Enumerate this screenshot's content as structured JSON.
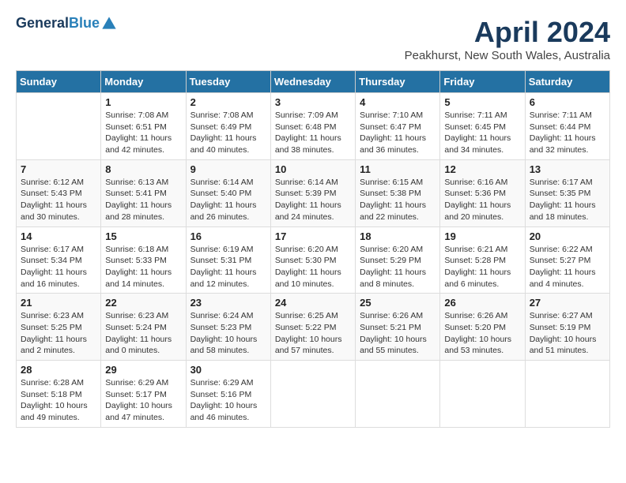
{
  "header": {
    "logo_line1": "General",
    "logo_line2": "Blue",
    "month": "April 2024",
    "location": "Peakhurst, New South Wales, Australia"
  },
  "weekdays": [
    "Sunday",
    "Monday",
    "Tuesday",
    "Wednesday",
    "Thursday",
    "Friday",
    "Saturday"
  ],
  "weeks": [
    [
      {
        "day": "",
        "info": ""
      },
      {
        "day": "1",
        "info": "Sunrise: 7:08 AM\nSunset: 6:51 PM\nDaylight: 11 hours\nand 42 minutes."
      },
      {
        "day": "2",
        "info": "Sunrise: 7:08 AM\nSunset: 6:49 PM\nDaylight: 11 hours\nand 40 minutes."
      },
      {
        "day": "3",
        "info": "Sunrise: 7:09 AM\nSunset: 6:48 PM\nDaylight: 11 hours\nand 38 minutes."
      },
      {
        "day": "4",
        "info": "Sunrise: 7:10 AM\nSunset: 6:47 PM\nDaylight: 11 hours\nand 36 minutes."
      },
      {
        "day": "5",
        "info": "Sunrise: 7:11 AM\nSunset: 6:45 PM\nDaylight: 11 hours\nand 34 minutes."
      },
      {
        "day": "6",
        "info": "Sunrise: 7:11 AM\nSunset: 6:44 PM\nDaylight: 11 hours\nand 32 minutes."
      }
    ],
    [
      {
        "day": "7",
        "info": "Sunrise: 6:12 AM\nSunset: 5:43 PM\nDaylight: 11 hours\nand 30 minutes."
      },
      {
        "day": "8",
        "info": "Sunrise: 6:13 AM\nSunset: 5:41 PM\nDaylight: 11 hours\nand 28 minutes."
      },
      {
        "day": "9",
        "info": "Sunrise: 6:14 AM\nSunset: 5:40 PM\nDaylight: 11 hours\nand 26 minutes."
      },
      {
        "day": "10",
        "info": "Sunrise: 6:14 AM\nSunset: 5:39 PM\nDaylight: 11 hours\nand 24 minutes."
      },
      {
        "day": "11",
        "info": "Sunrise: 6:15 AM\nSunset: 5:38 PM\nDaylight: 11 hours\nand 22 minutes."
      },
      {
        "day": "12",
        "info": "Sunrise: 6:16 AM\nSunset: 5:36 PM\nDaylight: 11 hours\nand 20 minutes."
      },
      {
        "day": "13",
        "info": "Sunrise: 6:17 AM\nSunset: 5:35 PM\nDaylight: 11 hours\nand 18 minutes."
      }
    ],
    [
      {
        "day": "14",
        "info": "Sunrise: 6:17 AM\nSunset: 5:34 PM\nDaylight: 11 hours\nand 16 minutes."
      },
      {
        "day": "15",
        "info": "Sunrise: 6:18 AM\nSunset: 5:33 PM\nDaylight: 11 hours\nand 14 minutes."
      },
      {
        "day": "16",
        "info": "Sunrise: 6:19 AM\nSunset: 5:31 PM\nDaylight: 11 hours\nand 12 minutes."
      },
      {
        "day": "17",
        "info": "Sunrise: 6:20 AM\nSunset: 5:30 PM\nDaylight: 11 hours\nand 10 minutes."
      },
      {
        "day": "18",
        "info": "Sunrise: 6:20 AM\nSunset: 5:29 PM\nDaylight: 11 hours\nand 8 minutes."
      },
      {
        "day": "19",
        "info": "Sunrise: 6:21 AM\nSunset: 5:28 PM\nDaylight: 11 hours\nand 6 minutes."
      },
      {
        "day": "20",
        "info": "Sunrise: 6:22 AM\nSunset: 5:27 PM\nDaylight: 11 hours\nand 4 minutes."
      }
    ],
    [
      {
        "day": "21",
        "info": "Sunrise: 6:23 AM\nSunset: 5:25 PM\nDaylight: 11 hours\nand 2 minutes."
      },
      {
        "day": "22",
        "info": "Sunrise: 6:23 AM\nSunset: 5:24 PM\nDaylight: 11 hours\nand 0 minutes."
      },
      {
        "day": "23",
        "info": "Sunrise: 6:24 AM\nSunset: 5:23 PM\nDaylight: 10 hours\nand 58 minutes."
      },
      {
        "day": "24",
        "info": "Sunrise: 6:25 AM\nSunset: 5:22 PM\nDaylight: 10 hours\nand 57 minutes."
      },
      {
        "day": "25",
        "info": "Sunrise: 6:26 AM\nSunset: 5:21 PM\nDaylight: 10 hours\nand 55 minutes."
      },
      {
        "day": "26",
        "info": "Sunrise: 6:26 AM\nSunset: 5:20 PM\nDaylight: 10 hours\nand 53 minutes."
      },
      {
        "day": "27",
        "info": "Sunrise: 6:27 AM\nSunset: 5:19 PM\nDaylight: 10 hours\nand 51 minutes."
      }
    ],
    [
      {
        "day": "28",
        "info": "Sunrise: 6:28 AM\nSunset: 5:18 PM\nDaylight: 10 hours\nand 49 minutes."
      },
      {
        "day": "29",
        "info": "Sunrise: 6:29 AM\nSunset: 5:17 PM\nDaylight: 10 hours\nand 47 minutes."
      },
      {
        "day": "30",
        "info": "Sunrise: 6:29 AM\nSunset: 5:16 PM\nDaylight: 10 hours\nand 46 minutes."
      },
      {
        "day": "",
        "info": ""
      },
      {
        "day": "",
        "info": ""
      },
      {
        "day": "",
        "info": ""
      },
      {
        "day": "",
        "info": ""
      }
    ]
  ]
}
